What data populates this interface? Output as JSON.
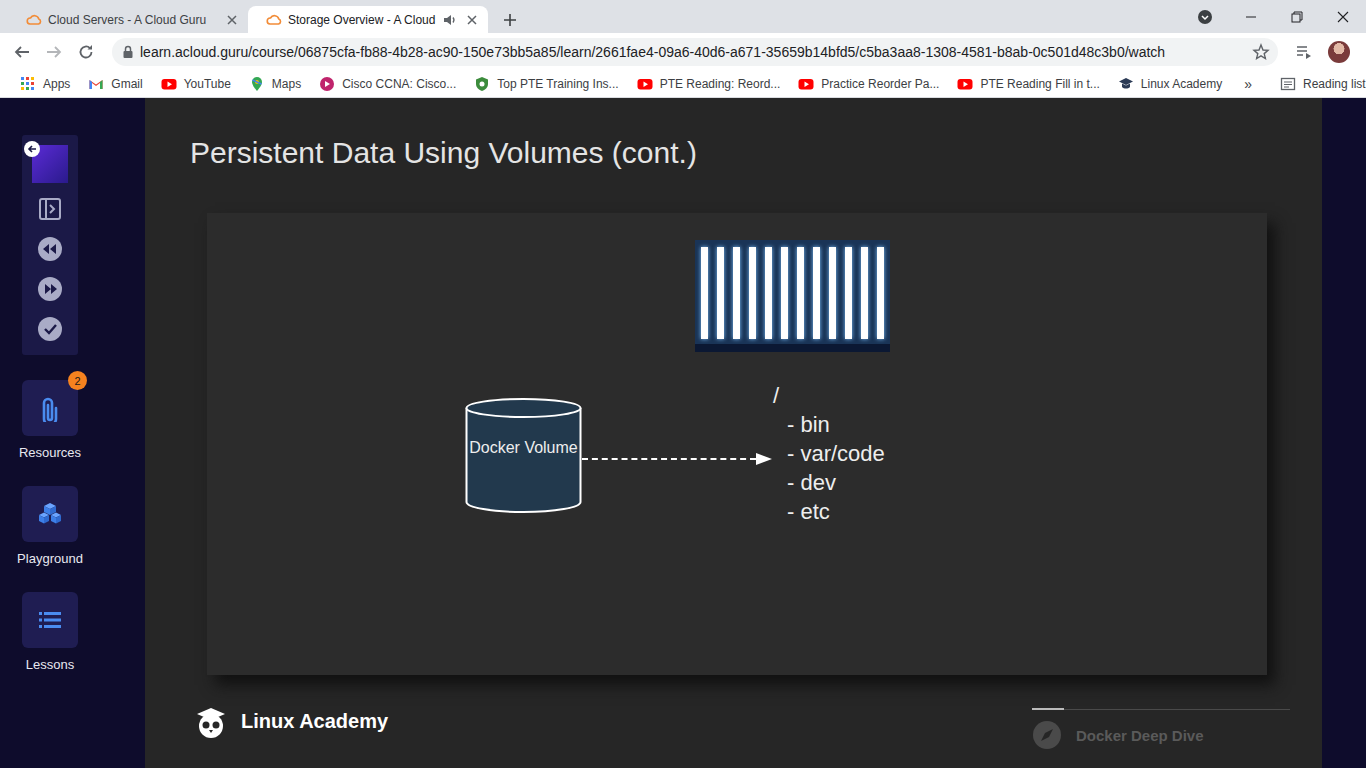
{
  "browser": {
    "tabs": [
      {
        "label": "Cloud Servers - A Cloud Guru",
        "selected": false,
        "audio": false
      },
      {
        "label": "Storage Overview - A Cloud",
        "selected": true,
        "audio": true
      }
    ],
    "url": "learn.acloud.guru/course/06875cfa-fb88-4b28-ac90-150e73bb5a85/learn/2661fae4-09a6-40d6-a671-35659b14bfd5/c5ba3aa8-1308-4581-b8ab-0c501d48c3b0/watch",
    "bookmarks": [
      "Apps",
      "Gmail",
      "YouTube",
      "Maps",
      "Cisco CCNA: Cisco...",
      "Top PTE Training Ins...",
      "PTE Reading: Reord...",
      "Practice Reorder Pa...",
      "PTE Reading Fill in t...",
      "Linux Academy"
    ],
    "more": "»",
    "reading_list": "Reading list"
  },
  "sidebar": {
    "items": [
      {
        "label": "Resources",
        "badge": "2"
      },
      {
        "label": "Playground",
        "badge": ""
      },
      {
        "label": "Lessons",
        "badge": ""
      }
    ]
  },
  "slide": {
    "title": "Persistent Data Using Volumes (cont.)",
    "volume_label": "Docker Volume",
    "tree": [
      "/",
      "- bin",
      "- var/code",
      "- dev",
      "- etc"
    ],
    "brand": "Linux Academy",
    "course": "Docker Deep Dive"
  }
}
